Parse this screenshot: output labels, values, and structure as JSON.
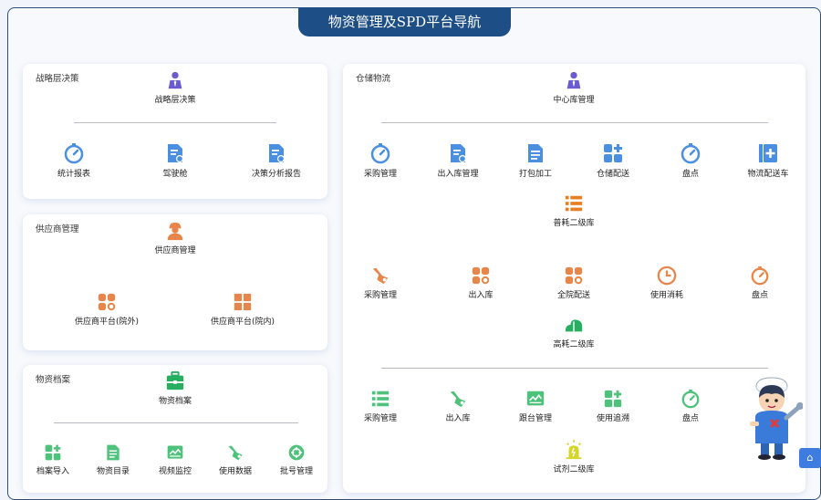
{
  "header": {
    "title": "物资管理及SPD平台导航"
  },
  "panels": {
    "analysis": {
      "title": "战略层决策",
      "top": {
        "label": "战略层决策",
        "icon": "person-icon"
      },
      "items": [
        {
          "label": "统计报表",
          "icon": "gauge-icon"
        },
        {
          "label": "驾驶舱",
          "icon": "document-chart-icon"
        },
        {
          "label": "决策分析报告",
          "icon": "document-chart-icon"
        }
      ]
    },
    "supplier": {
      "title": "供应商管理",
      "top": {
        "label": "供应商管理",
        "icon": "worker-icon"
      },
      "items": [
        {
          "label": "供应商平台(院外)",
          "icon": "grid-icon"
        },
        {
          "label": "供应商平台(院内)",
          "icon": "squares-icon"
        }
      ]
    },
    "archive": {
      "title": "物资档案",
      "top": {
        "label": "物资档案",
        "icon": "toolbox-icon"
      },
      "items": [
        {
          "label": "档案导入",
          "icon": "apps-icon"
        },
        {
          "label": "物资目录",
          "icon": "document-icon"
        },
        {
          "label": "视频监控",
          "icon": "monitor-icon"
        },
        {
          "label": "使用数据",
          "icon": "wrench-icon"
        },
        {
          "label": "批号管理",
          "icon": "settings-icon"
        }
      ]
    },
    "warehouse": {
      "title": "仓储物流",
      "top": {
        "label": "中心库管理",
        "icon": "person-icon"
      },
      "row1": [
        {
          "label": "采购管理",
          "icon": "gauge-icon"
        },
        {
          "label": "出入库管理",
          "icon": "document-chart-icon"
        },
        {
          "label": "打包加工",
          "icon": "document-icon"
        },
        {
          "label": "仓储配送",
          "icon": "apps-icon"
        },
        {
          "label": "盘点",
          "icon": "gauge-icon"
        },
        {
          "label": "物流配送车",
          "icon": "add-box-icon"
        }
      ],
      "mid1": {
        "label": "普耗二级库",
        "icon": "list-icon"
      },
      "row2": [
        {
          "label": "采购管理",
          "icon": "wrench-icon"
        },
        {
          "label": "出入库",
          "icon": "grid-icon"
        },
        {
          "label": "全院配送",
          "icon": "grid-icon"
        },
        {
          "label": "使用消耗",
          "icon": "clock-icon"
        },
        {
          "label": "盘点",
          "icon": "gauge-icon"
        }
      ],
      "mid2": {
        "label": "高耗二级库",
        "icon": "cloud-icon"
      },
      "row3": [
        {
          "label": "采购管理",
          "icon": "list-icon"
        },
        {
          "label": "出入库",
          "icon": "wrench-icon"
        },
        {
          "label": "跟台管理",
          "icon": "monitor-icon"
        },
        {
          "label": "使用追溯",
          "icon": "apps-icon"
        },
        {
          "label": "盘点",
          "icon": "gauge-icon"
        }
      ],
      "bottom": {
        "label": "试剂二级库",
        "icon": "lamp-icon"
      }
    }
  },
  "floating_button": {
    "label": "⌂"
  },
  "colors": {
    "accent": "#1d4e86",
    "blue_icon": "#4a8fe0",
    "orange_icon": "#e7864a",
    "green_icon": "#27ae60"
  }
}
